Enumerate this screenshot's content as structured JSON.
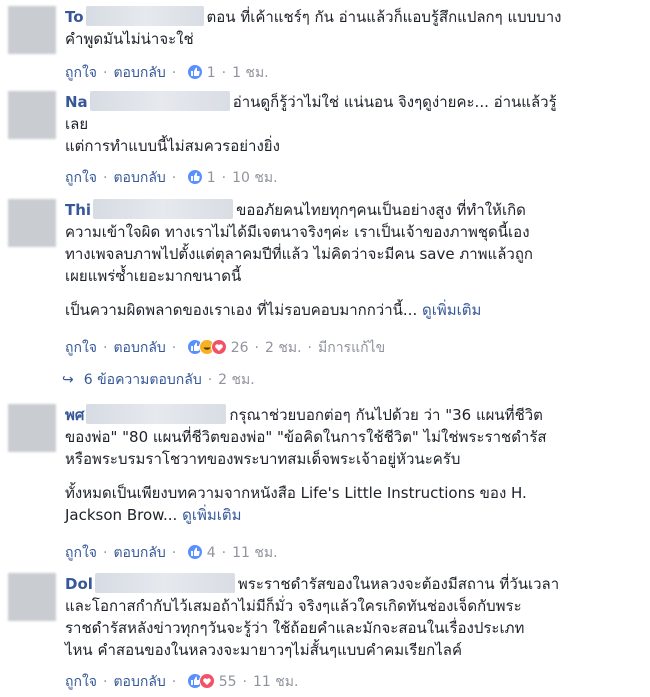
{
  "actions": {
    "like": "ถูกใจ",
    "reply": "ตอบกลับ"
  },
  "comments": [
    {
      "name": "To",
      "lines": [
        "ตอน ที่เค้าแชร์ๆ กัน อ่านแล้วก็แอบรู้สึกแปลกๆ แบบบาง",
        "คำพูดมันไม่น่าจะใช่"
      ],
      "reactions": [
        "like"
      ],
      "count": "1",
      "time": "1 ชม."
    },
    {
      "name": "Na",
      "lines": [
        "อ่านดูก็รู้ว่าไม่ใช่ แน่นอน จิงๆดูง่ายคะ... อ่านแล้วรู้",
        "เลย",
        "แต่การทำแบบนี้ไม่สมควรอย่างยิ่ง"
      ],
      "reactions": [
        "like"
      ],
      "count": "1",
      "time": "10 ชม."
    },
    {
      "name": "Thi",
      "lines": [
        "ขออภัยคนไทยทุกๆคนเป็นอย่างสูง ที่ทำให้เกิด",
        "ความเข้าใจผิด ทางเราไม่ได้มีเจตนาจริงๆค่ะ เราเป็นเจ้าของภาพชุดนี้เอง",
        "ทางเพจลบภาพไปตั้งแต่ตุลาคมปีที่แล้ว ไม่คิดว่าจะมีคน save ภาพแล้วถูก",
        "เผยแพร่ซ้ำเยอะมากขนาดนี้"
      ],
      "para2": "เป็นความผิดพลาดของเราเอง ที่ไม่รอบคอบมากกว่านี้...",
      "see_more": "ดูเพิ่มเติม",
      "reactions": [
        "like",
        "haha",
        "love"
      ],
      "count": "26",
      "time": "2 ชม.",
      "edited": "มีการแก้ไข",
      "replies_label": "6 ข้อความตอบกลับ",
      "replies_time": "2 ชม."
    },
    {
      "name": "พศ",
      "lines": [
        "กรุณาช่วยบอกต่อๆ กันไปด้วย ว่า \"36 แผนที่ชีวิต",
        "ของพ่อ\" \"80 แผนที่ชีวิตของพ่อ\" \"ข้อคิดในการใช้ชีวิต\" ไม่ใช่พระราชดำรัส",
        "หรือพระบรมราโชวาทของพระบาทสมเด็จพระเจ้าอยู่หัวนะครับ"
      ],
      "para2_lines": [
        "ทั้งหมดเป็นเพียงบทความจากหนังสือ Life's Little Instructions ของ H.",
        "Jackson Brow..."
      ],
      "see_more": "ดูเพิ่มเติม",
      "reactions": [
        "like"
      ],
      "count": "4",
      "time": "11 ชม."
    },
    {
      "name": "Dol",
      "lines": [
        "พระราชดำรัสของในหลวงจะต้องมีสถาน ที่วันเวลา",
        "และโอกาสกำกับไว้เสมอถ้าไม่มีก็มั่ว จริงๆแล้วใครเกิดทันช่องเจ็ดกับพระ",
        "ราชดำรัสหลังข่าวทุกๆวันจะรู้ว่า ใช้ถ้อยคำและมักจะสอนในเรื่องประเภท",
        "ไหน คำสอนของในหลวงจะมายาวๆไม่สั้นๆแบบคำคมเรียกไลค์"
      ],
      "reactions": [
        "like",
        "love"
      ],
      "count": "55",
      "time": "11 ชม."
    }
  ]
}
